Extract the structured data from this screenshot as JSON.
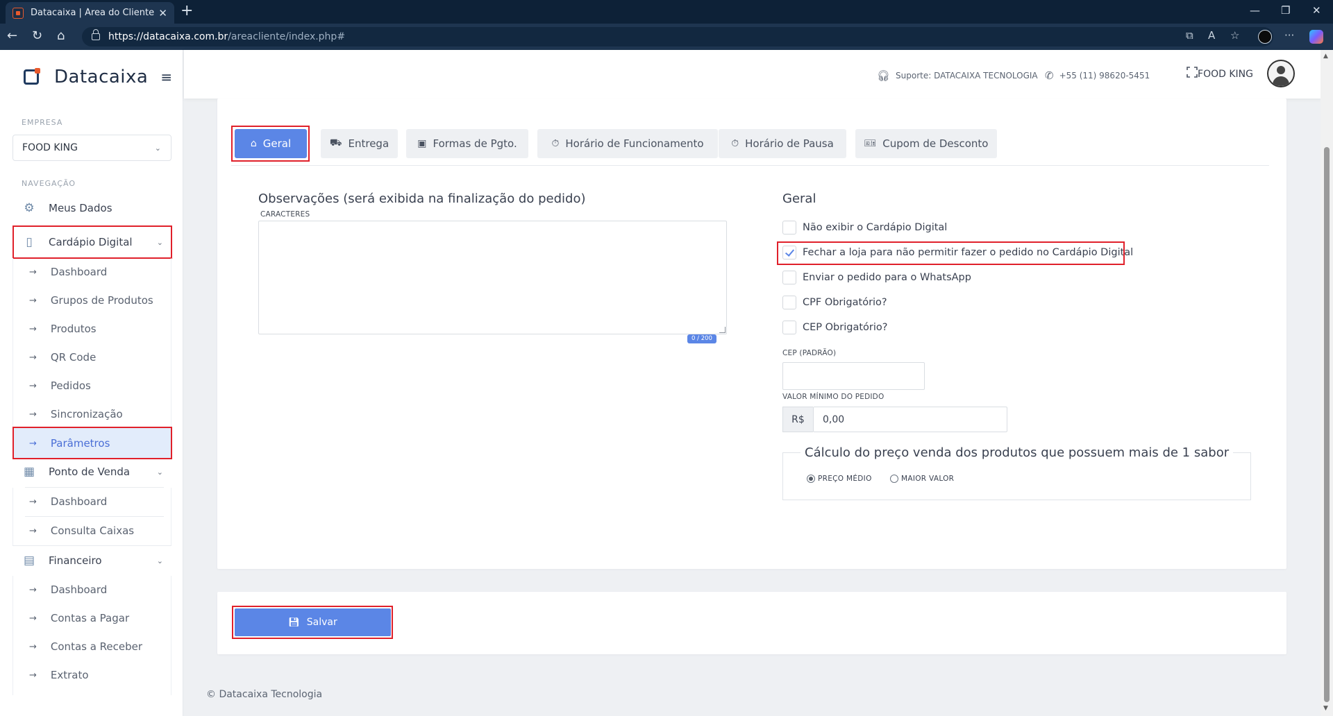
{
  "browser": {
    "tab_title": "Datacaixa | Área do Cliente",
    "close": "✕",
    "new_tab": "+",
    "url_host": "https://datacaixa.com.br",
    "url_path": "/areacliente/index.php#"
  },
  "sidebar": {
    "brand": "Datacaixa",
    "company_label": "EMPRESA",
    "company_value": "FOOD KING",
    "nav_label": "NAVEGAÇÃO",
    "meus_dados": "Meus Dados",
    "cardapio": {
      "label": "Cardápio Digital",
      "items": [
        "Dashboard",
        "Grupos de Produtos",
        "Produtos",
        "QR Code",
        "Pedidos",
        "Sincronização",
        "Parâmetros"
      ]
    },
    "pdv": {
      "label": "Ponto de Venda",
      "items": [
        "Dashboard",
        "Consulta Caixas"
      ]
    },
    "financeiro": {
      "label": "Financeiro",
      "items": [
        "Dashboard",
        "Contas a Pagar",
        "Contas a Receber",
        "Extrato"
      ]
    }
  },
  "header": {
    "support": "Suporte: DATACAIXA TECNOLOGIA",
    "phone": "+55 (11) 98620-5451",
    "user": "FOOD KING"
  },
  "tabs": [
    "Geral",
    "Entrega",
    "Formas de Pgto.",
    "Horário de Funcionamento",
    "Horário de Pausa",
    "Cupom de Desconto"
  ],
  "form": {
    "obs_title": "Observações (será exibida na finalização do pedido)",
    "chars_label": "CARACTERES",
    "counter": "0 / 200",
    "geral_title": "Geral",
    "checks": [
      {
        "label": "Não exibir o Cardápio Digital",
        "checked": false
      },
      {
        "label": "Fechar a loja para não permitir fazer o pedido no Cardápio Digital",
        "checked": true
      },
      {
        "label": "Enviar o pedido para o WhatsApp",
        "checked": false
      },
      {
        "label": "CPF Obrigatório?",
        "checked": false
      },
      {
        "label": "CEP Obrigatório?",
        "checked": false
      }
    ],
    "cep_label": "CEP (PADRÃO)",
    "cep_value": "",
    "min_label": "VALOR MÍNIMO DO PEDIDO",
    "currency": "R$",
    "min_value": "0,00",
    "calc_legend": "Cálculo do preço venda dos produtos que possuem mais de 1 sabor",
    "radio_medio": "PREÇO MÉDIO",
    "radio_maior": "MAIOR VALOR",
    "radio_selected": "PREÇO MÉDIO"
  },
  "save_label": "Salvar",
  "footer": "© Datacaixa Tecnologia",
  "colors": {
    "accent": "#5b86e6",
    "highlight": "#e0202a",
    "brand_dark": "#1f3a5f",
    "brand_orange": "#e85a2d"
  }
}
